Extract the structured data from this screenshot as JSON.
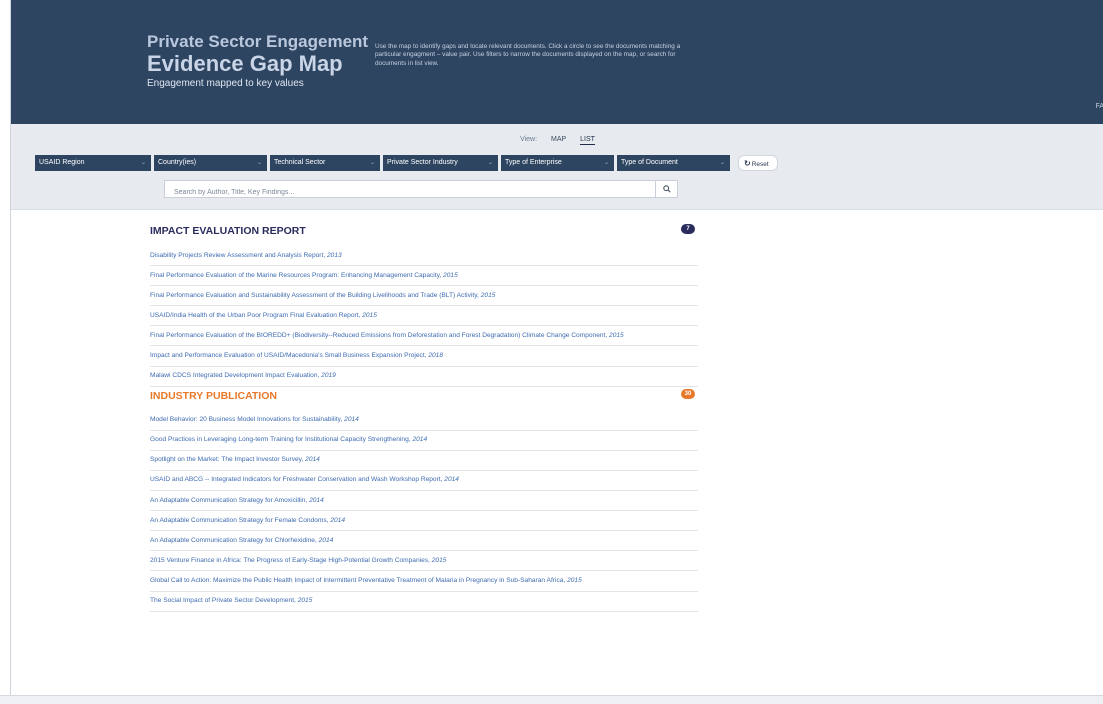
{
  "header": {
    "title_line1": "Private Sector Engagement",
    "title_line2": "Evidence Gap Map",
    "subtitle": "Engagement mapped to key values",
    "intro": "Use the map to identify gaps and locate relevant documents. Click a circle to see the documents matching a particular engagment – value pair. Use filters to narrow the documents displayed on the map, or search for documents in list view.",
    "faq": "FA"
  },
  "view": {
    "label": "View:",
    "map": "MAP",
    "list": "LIST",
    "active": "LIST"
  },
  "filters": [
    {
      "label": "USAID Region"
    },
    {
      "label": "Country(ies)"
    },
    {
      "label": "Technical Sector"
    },
    {
      "label": "Private Sector Industry"
    },
    {
      "label": "Type of Enterprise"
    },
    {
      "label": "Type of Document"
    }
  ],
  "reset_label": "Reset",
  "search": {
    "placeholder": "Search by Author, Title, Key Findings...",
    "icon": "search-icon"
  },
  "sections": [
    {
      "title": "IMPACT EVALUATION REPORT",
      "badge": "7",
      "color": "#2b2c5e",
      "docs": [
        {
          "title": "Disability Projects Review Assessment and Analysis Report,",
          "year": "2013"
        },
        {
          "title": "Final Performance Evaluation of the Marine Resources Program: Enhancing Management Capacity,",
          "year": "2015"
        },
        {
          "title": "Final Performance Evaluation and Sustainability Assessment of the Building Livelihoods and Trade (BLT) Activity,",
          "year": "2015"
        },
        {
          "title": "USAID/India Health of the Urban Poor Program Final Evaluation Report,",
          "year": "2015"
        },
        {
          "title": "Final Performance Evaluation of the BIOREDD+ (Biodiversity--Reduced Emissions from Deforestation and Forest Degradation) Climate Change Component,",
          "year": "2015"
        },
        {
          "title": "Impact and Performance Evaluation of USAID/Macedonia's Small Business Expansion Project,",
          "year": "2018"
        },
        {
          "title": "Malawi CDCS Integrated Development Impact Evaluation,",
          "year": "2019"
        }
      ]
    },
    {
      "title": "INDUSTRY PUBLICATION",
      "badge": "30",
      "color": "#e8792a",
      "docs": [
        {
          "title": "Model Behavior: 20 Business Model Innovations for Sustainability,",
          "year": "2014"
        },
        {
          "title": "Good Practices in Leveraging Long-term Training for Institutional Capacity Strengthening,",
          "year": "2014"
        },
        {
          "title": "Spotlight on the Market: The Impact Investor Survey,",
          "year": "2014"
        },
        {
          "title": "USAID and ABCG -- Integrated Indicators for Freshwater Conservation and Wash Workshop Report,",
          "year": "2014"
        },
        {
          "title": "An Adaptable Communication Strategy for Amoxicillin,",
          "year": "2014"
        },
        {
          "title": "An Adaptable Communication Strategy for Female Condoms,",
          "year": "2014"
        },
        {
          "title": "An Adaptable Communication Strategy for Chlorhexidine,",
          "year": "2014"
        },
        {
          "title": "2015 Venture Finance in Africa: The Progress of Early-Stage High-Potential Growth Companies,",
          "year": "2015"
        },
        {
          "title": "Global Call to Action: Maximize the Public Health Impact of Intermittent Preventative Treatment of Malaria in Pregnancy in Sub-Saharan Africa,",
          "year": "2015"
        },
        {
          "title": "The Social Impact of Private Sector Development,",
          "year": "2015"
        }
      ]
    }
  ]
}
